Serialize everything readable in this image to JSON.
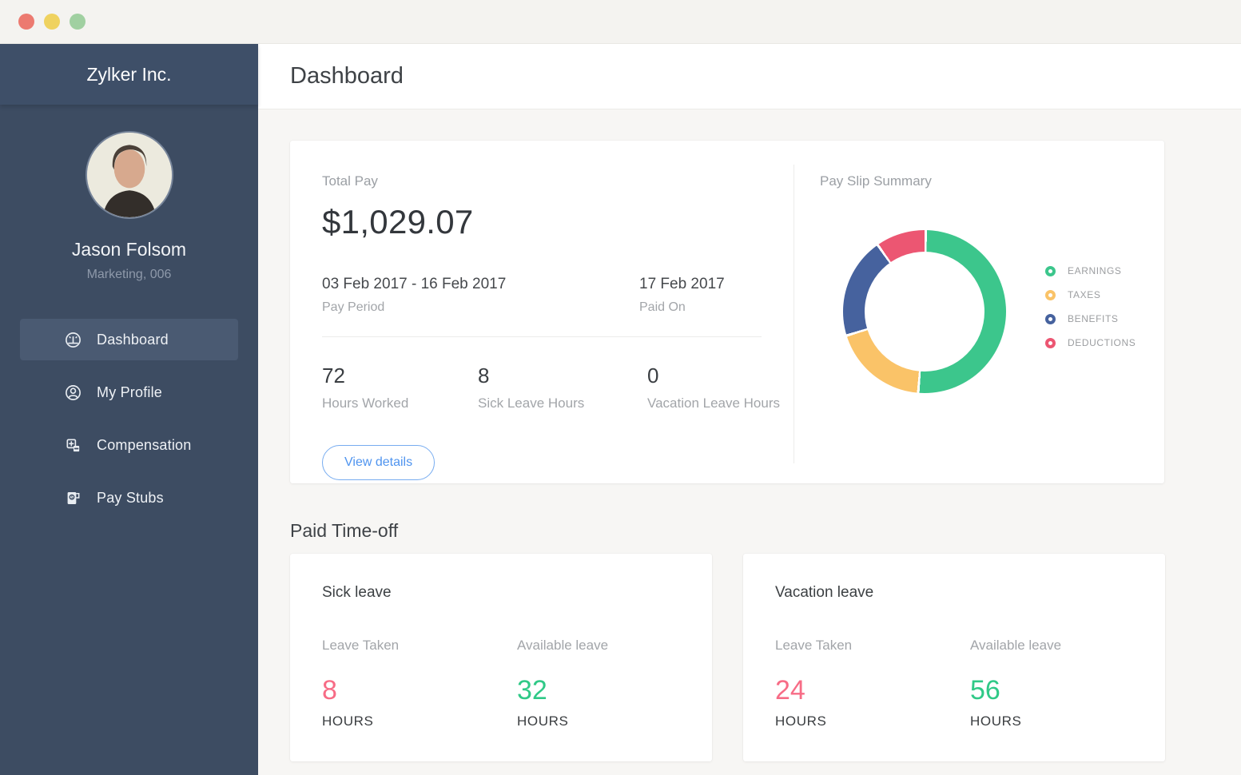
{
  "window": {
    "controls": {
      "close": "close",
      "minimize": "minimize",
      "zoom": "zoom"
    }
  },
  "sidebar": {
    "company": "Zylker Inc.",
    "profile": {
      "name": "Jason Folsom",
      "subtitle": "Marketing, 006"
    },
    "items": [
      {
        "label": "Dashboard",
        "icon": "gauge-icon",
        "active": true
      },
      {
        "label": "My Profile",
        "icon": "user-icon",
        "active": false
      },
      {
        "label": "Compensation",
        "icon": "compensation-icon",
        "active": false
      },
      {
        "label": "Pay Stubs",
        "icon": "paystub-icon",
        "active": false
      }
    ]
  },
  "header": {
    "title": "Dashboard"
  },
  "total_pay": {
    "label": "Total Pay",
    "amount": "$1,029.07",
    "pay_period": {
      "value": "03 Feb 2017 - 16 Feb 2017",
      "label": "Pay Period"
    },
    "paid_on": {
      "value": "17 Feb 2017",
      "label": "Paid On"
    },
    "stats": [
      {
        "value": "72",
        "label": "Hours Worked"
      },
      {
        "value": "8",
        "label": "Sick Leave Hours"
      },
      {
        "value": "0",
        "label": "Vacation Leave Hours"
      }
    ],
    "view_details_label": "View details"
  },
  "pay_slip_summary": {
    "title": "Pay Slip Summary"
  },
  "chart_data": {
    "type": "pie",
    "donut": true,
    "title": "Pay Slip Summary",
    "categories": [
      "EARNINGS",
      "TAXES",
      "BENEFITS",
      "DEDUCTIONS"
    ],
    "values": [
      51,
      19,
      20,
      10
    ],
    "value_unit": "percent-of-ring",
    "colors": [
      "#3cc68c",
      "#fac368",
      "#46629e",
      "#ec5672"
    ],
    "legend_position": "right",
    "start_angle_deg": 0,
    "direction": "clockwise"
  },
  "paid_time_off": {
    "title": "Paid Time-off",
    "cards": [
      {
        "title": "Sick leave",
        "leave_taken": {
          "label": "Leave Taken",
          "value": "8",
          "unit": "HOURS"
        },
        "available": {
          "label": "Available leave",
          "value": "32",
          "unit": "HOURS"
        }
      },
      {
        "title": "Vacation leave",
        "leave_taken": {
          "label": "Leave Taken",
          "value": "24",
          "unit": "HOURS"
        },
        "available": {
          "label": "Available leave",
          "value": "56",
          "unit": "HOURS"
        }
      }
    ]
  },
  "colors": {
    "sidebar": "#3d4c62",
    "sidebar_active_item": "#4a5a72",
    "accent_blue": "#4f94ef",
    "leave_taken_pink": "#f76c86",
    "available_green": "#30c987",
    "traffic_red": "#ec7a70",
    "traffic_yellow": "#efd25f",
    "traffic_green": "#a0d0a1"
  }
}
